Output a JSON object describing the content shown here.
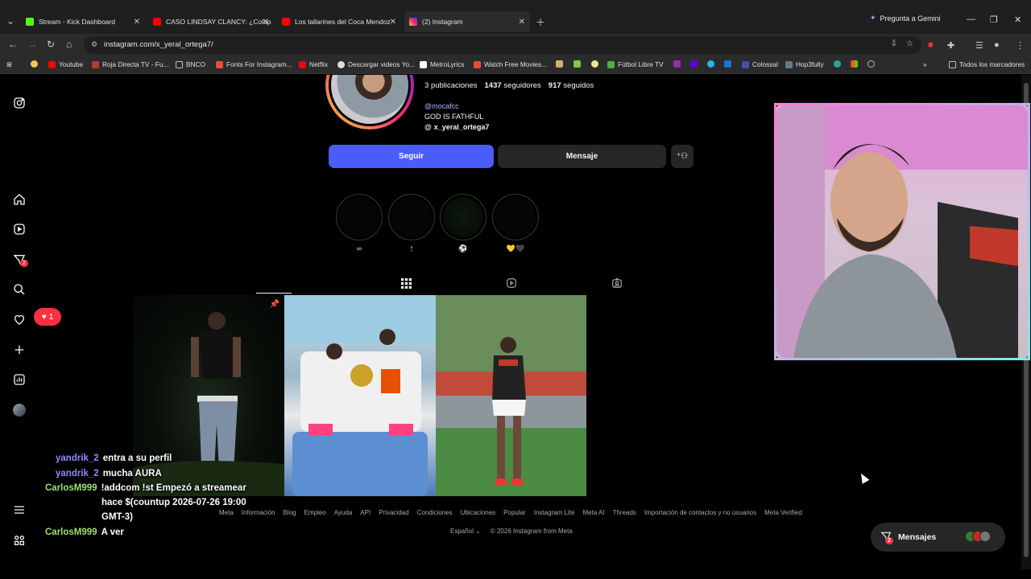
{
  "browser": {
    "tabs": [
      {
        "title": "Stream - Kick Dashboard",
        "favicon_color": "#53fc18"
      },
      {
        "title": "CASO LINDSAY CLANCY: ¿Colap",
        "favicon_color": "#ff0000"
      },
      {
        "title": "Los tallarines del Coca Mendoz",
        "favicon_color": "#ff0000"
      },
      {
        "title": "(2) Instagram",
        "favicon_color": "#e1306c",
        "active": true
      }
    ],
    "gemini_label": "Pregunta a Gemini",
    "url": "instagram.com/x_yeral_ortega7/",
    "bookmarks": [
      {
        "label": "",
        "icon": "emoji-icon",
        "color": "#f9c74f"
      },
      {
        "label": "Youtube",
        "icon": "youtube-icon",
        "color": "#ff0000"
      },
      {
        "label": "Roja Directa TV - Fu...",
        "icon": "rojadirecta-icon",
        "color": "#c0392b"
      },
      {
        "label": "BNCO",
        "icon": "folder-icon",
        "color": "#bdbdbd"
      },
      {
        "label": "Fonts For Instagram...",
        "icon": "fonts-icon",
        "color": "#e74c3c"
      },
      {
        "label": "Netflix",
        "icon": "netflix-icon",
        "color": "#e50914"
      },
      {
        "label": "Descargar videos Yo...",
        "icon": "download-icon",
        "color": "#dddddd"
      },
      {
        "label": "MetroLyrics",
        "icon": "metrolyrics-icon",
        "color": "#ffffff"
      },
      {
        "label": "Watch Free Movies...",
        "icon": "movies-icon",
        "color": "#e74c3c"
      },
      {
        "label": "Fútbol Libre TV",
        "icon": "futbol-icon",
        "color": "#4caf50"
      },
      {
        "label": "Colossal",
        "icon": "colossal-icon",
        "color": "#3f51b5"
      },
      {
        "label": "Hop3fully",
        "icon": "hop3fully-icon",
        "color": "#607d8b"
      },
      {
        "label": "Todos los marcadores",
        "icon": "folder-icon",
        "color": "#bdbdbd"
      }
    ]
  },
  "profile": {
    "posts_count": "3",
    "posts_label": "publicaciones",
    "followers_count": "1437",
    "followers_label": "seguidores",
    "following_count": "917",
    "following_label": "seguidos",
    "bio_mention": "@mocafcc",
    "bio_text": "GOD IS FATHFUL",
    "threads_handle": "x_yeral_ortega7",
    "follow_label": "Seguir",
    "message_label": "Mensaje"
  },
  "highlights": [
    {
      "label": "∞"
    },
    {
      "label": "🕯"
    },
    {
      "label": "⚽"
    },
    {
      "label": "💛🖤"
    }
  ],
  "sidebar": {
    "direct_badge": "2",
    "notification_count": "1"
  },
  "chat": [
    {
      "user": "yandrik_2",
      "user_color": "#8f8bff",
      "message": "entra a su perfil"
    },
    {
      "user": "yandrik_2",
      "user_color": "#8f8bff",
      "message": "mucha AURA"
    },
    {
      "user": "CarlosM999",
      "user_color": "#9be36b",
      "message": "!addcom !st Empezó a streamear"
    },
    {
      "user": "",
      "user_color": "#9be36b",
      "message": "hace $(countup 2026-07-26 19:00"
    },
    {
      "user": "",
      "user_color": "#9be36b",
      "message": "GMT-3)"
    },
    {
      "user": "CarlosM999",
      "user_color": "#9be36b",
      "message": "A ver"
    }
  ],
  "footer": {
    "links": [
      "Meta",
      "Información",
      "Blog",
      "Empleo",
      "Ayuda",
      "API",
      "Privacidad",
      "Condiciones",
      "Ubicaciones",
      "Popular",
      "Instagram Lite",
      "Meta AI",
      "Threads",
      "Importación de contactos y no usuarios",
      "Meta Verified"
    ],
    "language": "Español",
    "copyright": "© 2026 Instagram from Meta"
  },
  "messages_pill": {
    "label": "Mensajes",
    "badge": "2"
  }
}
